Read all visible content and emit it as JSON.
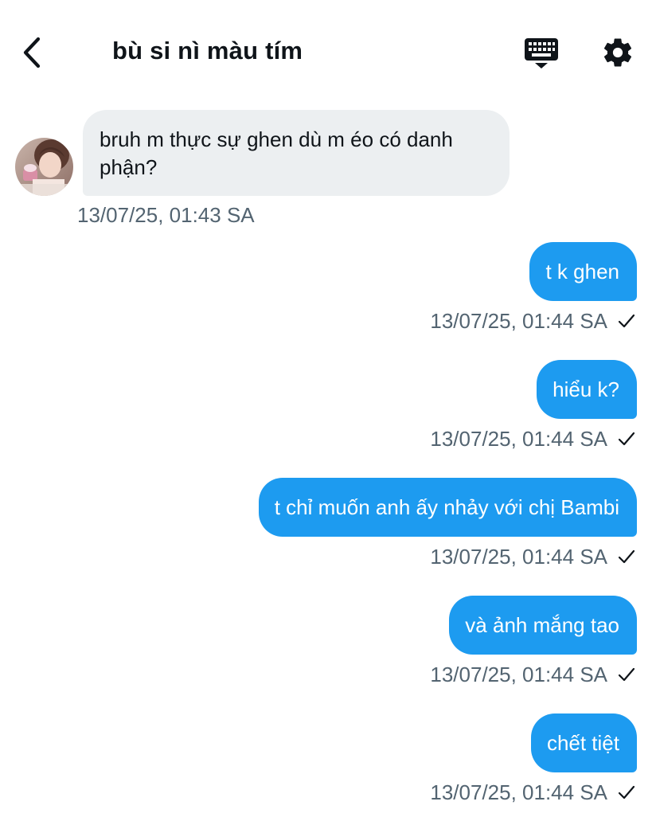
{
  "header": {
    "title": "bù si nì màu tím",
    "back_icon": "chevron-left-icon",
    "keyboard_icon": "keyboard-icon",
    "settings_icon": "gear-icon"
  },
  "colors": {
    "outgoing_bubble": "#1d9bf0",
    "incoming_bubble": "#eceff1",
    "timestamp": "#536471",
    "text": "#0f1419"
  },
  "messages": [
    {
      "direction": "incoming",
      "text": "bruh m thực sự ghen dù m éo có danh phận?",
      "time": "13/07/25, 01:43 SA",
      "status_icon": ""
    },
    {
      "direction": "outgoing",
      "text": "t k ghen",
      "time": "13/07/25, 01:44 SA",
      "status_icon": "check-icon"
    },
    {
      "direction": "outgoing",
      "text": "hiểu k?",
      "time": "13/07/25, 01:44 SA",
      "status_icon": "check-icon"
    },
    {
      "direction": "outgoing",
      "text": "t chỉ muốn anh ấy nhảy với chị Bambi",
      "time": "13/07/25, 01:44 SA",
      "status_icon": "check-icon"
    },
    {
      "direction": "outgoing",
      "text": "và ảnh mắng tao",
      "time": "13/07/25, 01:44 SA",
      "status_icon": "check-icon"
    },
    {
      "direction": "outgoing",
      "text": "chết tiệt",
      "time": "13/07/25, 01:44 SA",
      "status_icon": "check-icon"
    }
  ]
}
